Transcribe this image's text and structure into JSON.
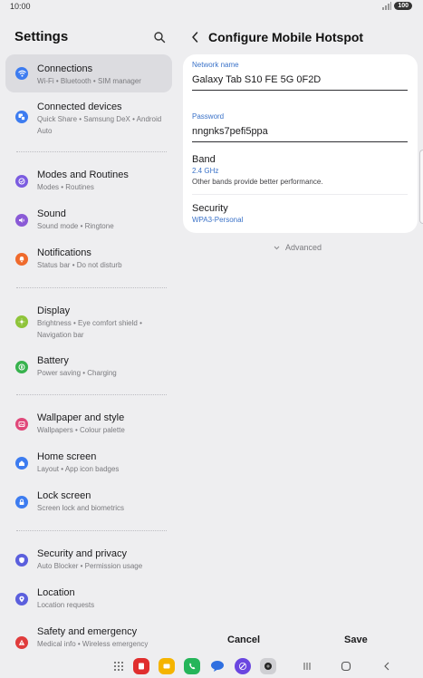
{
  "status_bar": {
    "time": "10:00",
    "battery": "100"
  },
  "settings": {
    "title": "Settings",
    "items": [
      {
        "title": "Connections",
        "subtitle": "Wi-Fi • Bluetooth • SIM manager",
        "color": "#3d7cf0",
        "icon": "wifi-icon"
      },
      {
        "title": "Connected devices",
        "subtitle": "Quick Share • Samsung DeX • Android Auto",
        "color": "#3d7cf0",
        "icon": "connected-devices-icon"
      },
      {
        "title": "Modes and Routines",
        "subtitle": "Modes • Routines",
        "color": "#7b5ce0",
        "icon": "modes-icon"
      },
      {
        "title": "Sound",
        "subtitle": "Sound mode • Ringtone",
        "color": "#8a5ad6",
        "icon": "sound-icon"
      },
      {
        "title": "Notifications",
        "subtitle": "Status bar • Do not disturb",
        "color": "#ef6a2c",
        "icon": "notifications-icon"
      },
      {
        "title": "Display",
        "subtitle": "Brightness • Eye comfort shield • Navigation bar",
        "color": "#8fc43a",
        "icon": "display-icon"
      },
      {
        "title": "Battery",
        "subtitle": "Power saving • Charging",
        "color": "#37b24d",
        "icon": "battery-icon"
      },
      {
        "title": "Wallpaper and style",
        "subtitle": "Wallpapers • Colour palette",
        "color": "#e0487a",
        "icon": "wallpaper-icon"
      },
      {
        "title": "Home screen",
        "subtitle": "Layout • App icon badges",
        "color": "#3d7cf0",
        "icon": "home-icon"
      },
      {
        "title": "Lock screen",
        "subtitle": "Screen lock and biometrics",
        "color": "#3d7cf0",
        "icon": "lock-icon"
      },
      {
        "title": "Security and privacy",
        "subtitle": "Auto Blocker • Permission usage",
        "color": "#5b5fdd",
        "icon": "shield-icon"
      },
      {
        "title": "Location",
        "subtitle": "Location requests",
        "color": "#5b5fdd",
        "icon": "location-icon"
      },
      {
        "title": "Safety and emergency",
        "subtitle": "Medical info • Wireless emergency",
        "color": "#e03c3c",
        "icon": "safety-icon"
      }
    ]
  },
  "hotspot": {
    "title": "Configure Mobile Hotspot",
    "network_name_label": "Network name",
    "network_name": "Galaxy Tab S10 FE 5G 0F2D",
    "password_label": "Password",
    "password": "nngnks7pefi5ppa",
    "band_label": "Band",
    "band_value": "2.4 GHz",
    "band_desc": "Other bands provide better performance.",
    "security_label": "Security",
    "security_value": "WPA3-Personal",
    "advanced_label": "Advanced",
    "cancel_label": "Cancel",
    "save_label": "Save",
    "accent": "#3a72c8"
  },
  "nav_bar": {
    "apps": [
      {
        "icon": "all-apps-icon",
        "color": "#555555"
      },
      {
        "icon": "notes-app-icon",
        "color": "#e02e2e"
      },
      {
        "icon": "files-app-icon",
        "color": "#f5b400"
      },
      {
        "icon": "phone-app-icon",
        "color": "#25b55a"
      },
      {
        "icon": "messages-app-icon",
        "color": "#2f6fe0"
      },
      {
        "icon": "internet-app-icon",
        "color": "#6a46e0"
      },
      {
        "icon": "camera-app-icon",
        "color": "#cfcfd3"
      }
    ]
  }
}
